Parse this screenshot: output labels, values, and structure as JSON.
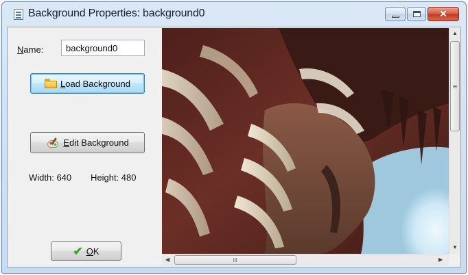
{
  "window": {
    "title": "Background Properties: background0",
    "title_icon": "document-icon",
    "minimize_icon": "minimize-icon",
    "maximize_icon": "maximize-icon",
    "close_icon": "close-icon",
    "close_glyph": "✕"
  },
  "form": {
    "name_label_accel": "N",
    "name_label_rest": "ame:",
    "name_value": "background0",
    "load_button": {
      "accel": "L",
      "rest": "oad Background",
      "icon": "folder-icon"
    },
    "edit_button": {
      "accel": "E",
      "rest": "dit Background",
      "icon": "paint-palette-icon"
    },
    "width_text": "Width: 640",
    "height_text": "Height: 480",
    "ok_button": {
      "accel": "O",
      "rest": "K",
      "icon": "checkmark-icon",
      "check_glyph": "✔"
    }
  },
  "preview": {
    "description_icon": "background-image",
    "colors": {
      "dark_red": "#5a2420",
      "brown": "#7a3a2c",
      "bone": "#d8cdb8",
      "sky": "#d6ecf7"
    }
  },
  "scrollbars": {
    "up_glyph": "▲",
    "down_glyph": "▼",
    "left_glyph": "◀",
    "right_glyph": "▶"
  }
}
